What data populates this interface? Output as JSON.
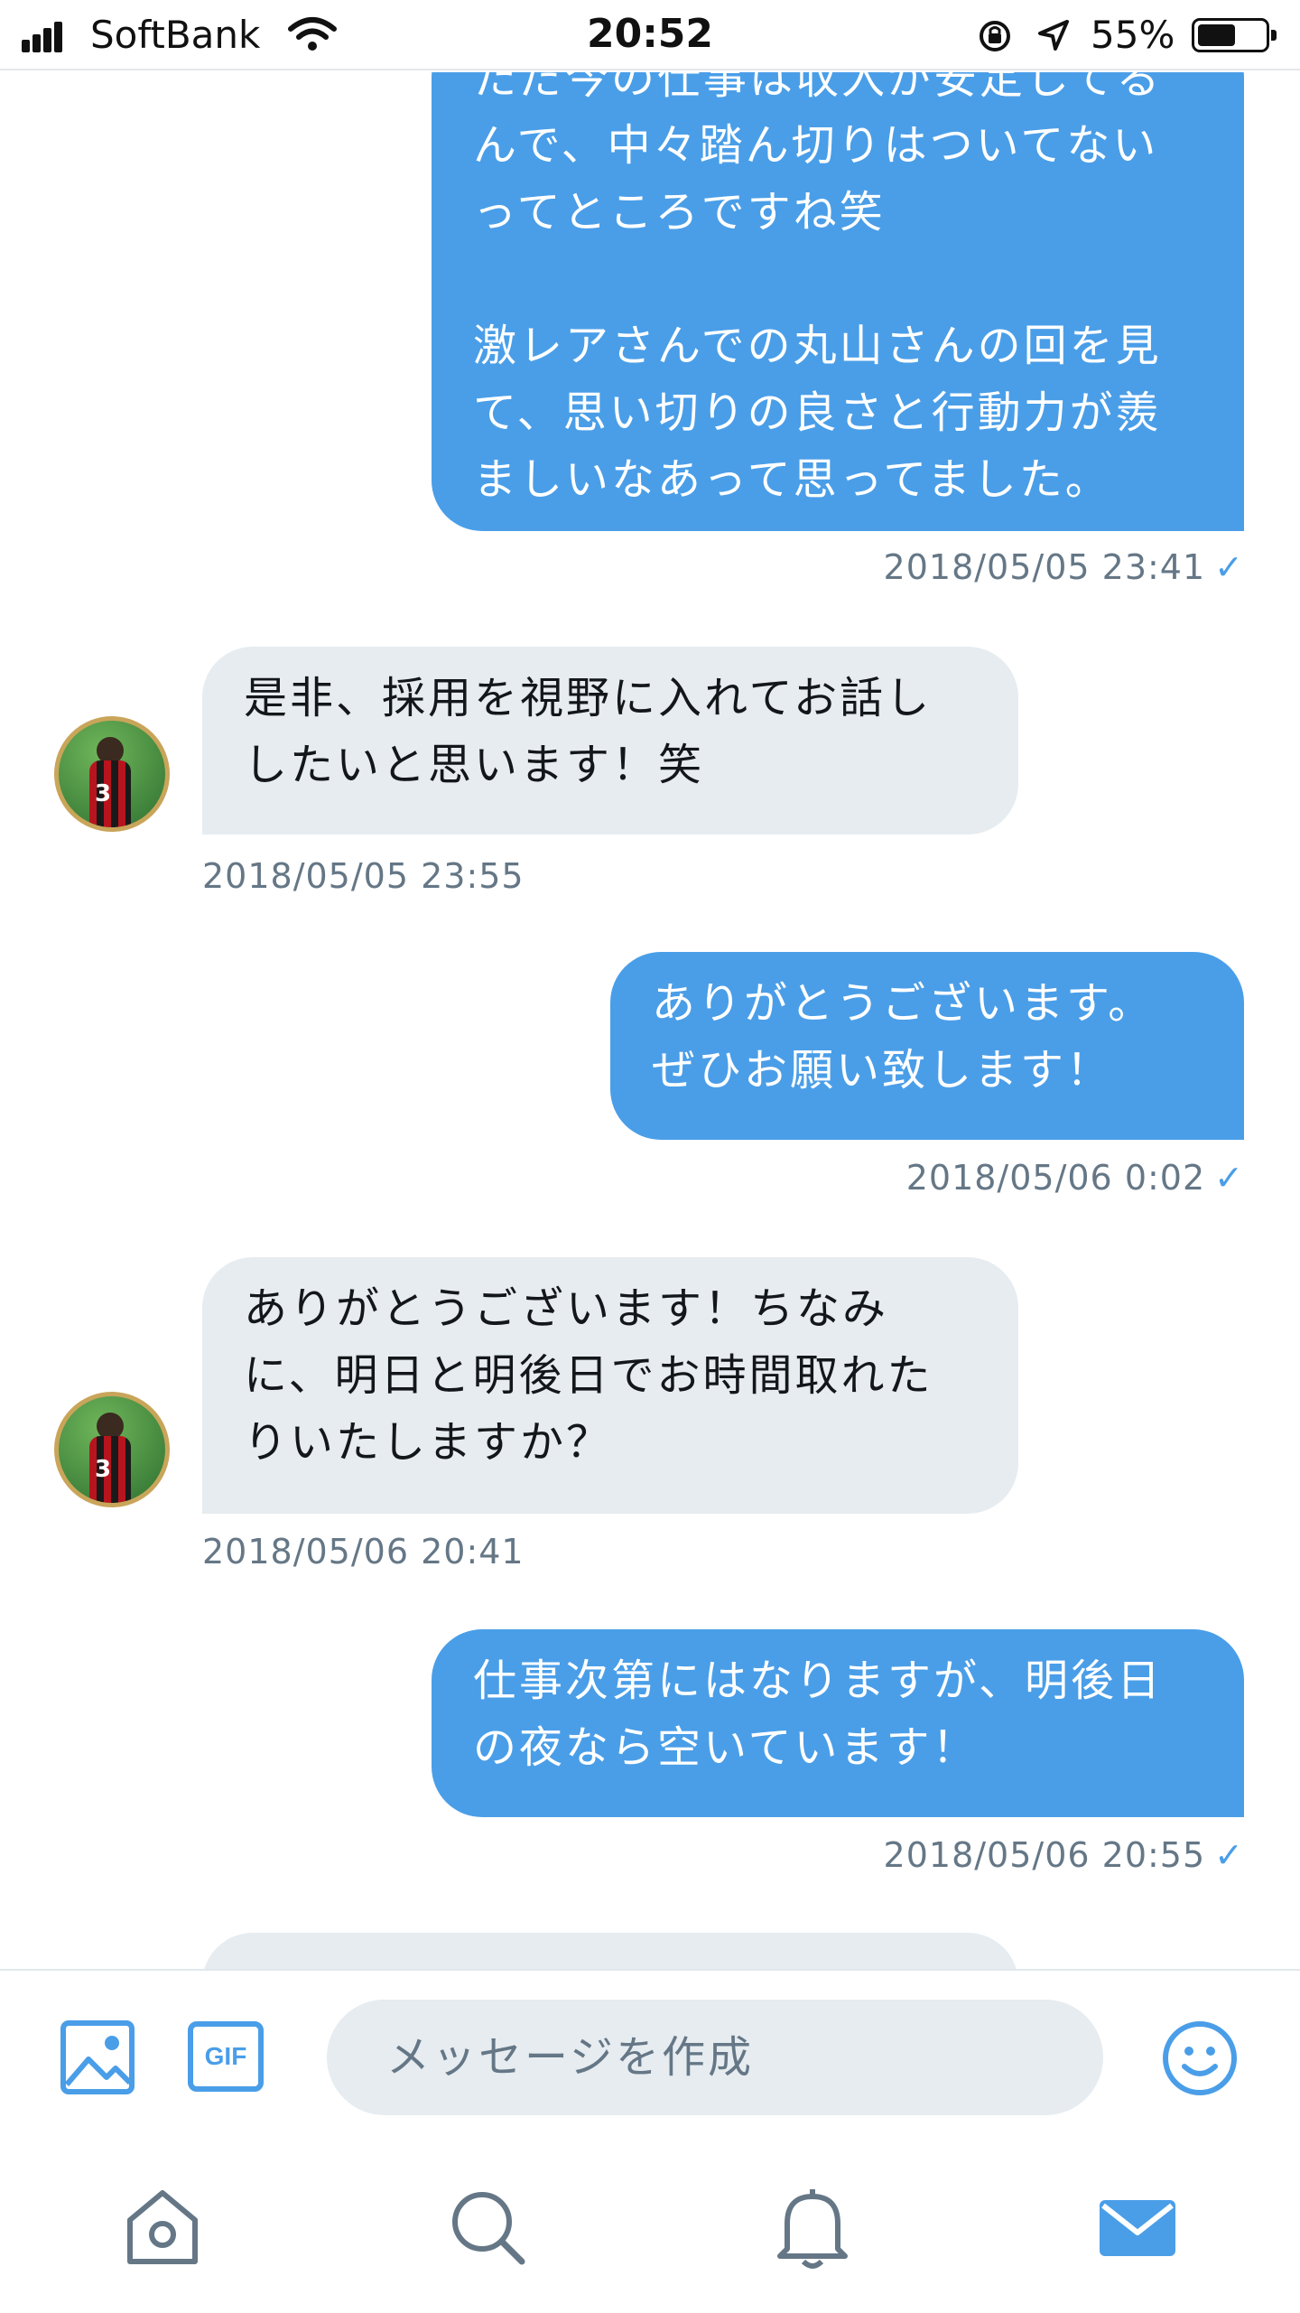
{
  "status_bar": {
    "carrier": "SoftBank",
    "time": "20:52",
    "battery": "55%",
    "battery_level": 0.55
  },
  "messages": [
    {
      "from": "me",
      "text": "ただ今の仕事は収入が安定してるんで、中々踏ん切りはついてないってところですね笑\n\n激レアさんでの丸山さんの回を見て、思い切りの良さと行動力が羨ましいなあって思ってました。",
      "time": "2018/05/05 23:41",
      "read_mark": "✓"
    },
    {
      "from": "them",
      "text": "是非、採用を視野に入れてお話ししたいと思います！笑",
      "time": "2018/05/05 23:55"
    },
    {
      "from": "me",
      "text": "ありがとうございます。\nぜひお願い致します！",
      "time": "2018/05/06 0:02",
      "read_mark": "✓"
    },
    {
      "from": "them",
      "text": "ありがとうございます！ちなみに、明日と明後日でお時間取れたりいたしますか？",
      "time": "2018/05/06 20:41"
    },
    {
      "from": "me",
      "text": "仕事次第にはなりますが、明後日の夜なら空いています！",
      "time": "2018/05/06 20:55",
      "read_mark": "✓"
    }
  ],
  "avatar": {
    "jersey_number": "3"
  },
  "composer": {
    "placeholder": "メッセージを作成",
    "gif_label": "GIF",
    "icons": [
      "image-icon",
      "gif-icon",
      "emoji-icon"
    ]
  },
  "tab_bar": {
    "items": [
      "home-icon",
      "search-icon",
      "notifications-icon",
      "messages-icon"
    ],
    "active": "messages-icon"
  },
  "colors": {
    "accent": "#4a9ee8",
    "incoming_bubble": "#e6ecf0",
    "meta_text": "#657786"
  }
}
